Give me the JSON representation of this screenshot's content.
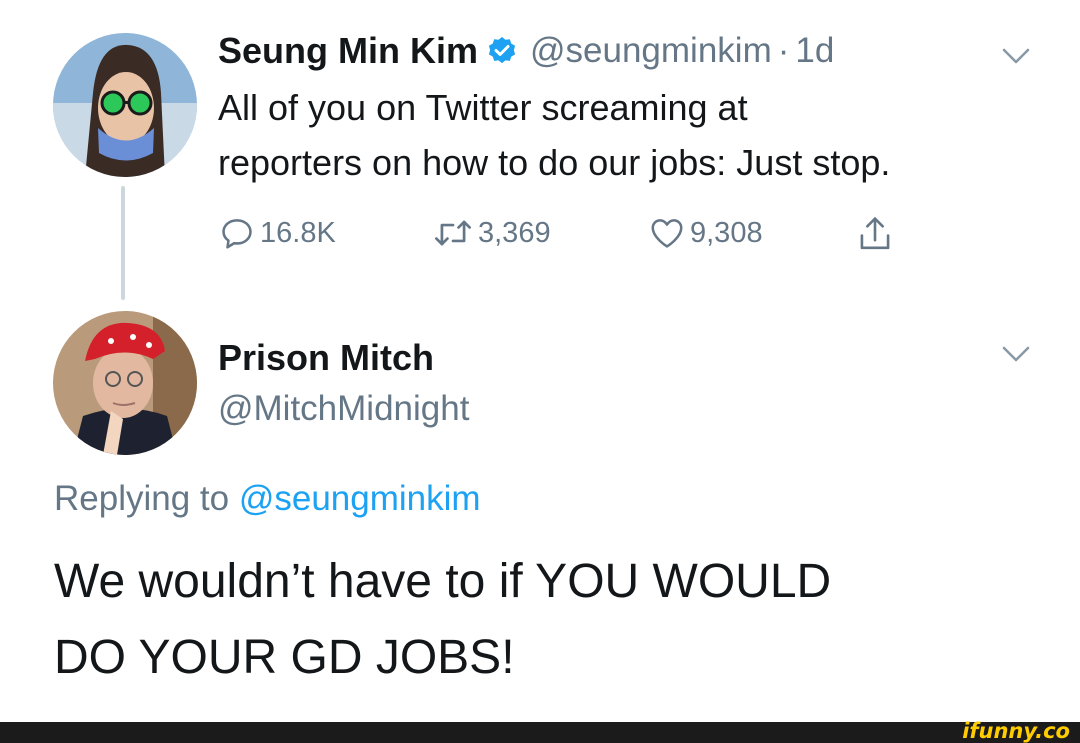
{
  "tweet": {
    "author_name": "Seung Min Kim",
    "handle": "@seungminkim",
    "separator": "·",
    "time": "1d",
    "text_line1": "All of you on Twitter screaming at",
    "text_line2": "reporters on how to do our jobs: Just stop.",
    "replies": "16.8K",
    "retweets": "3,369",
    "likes": "9,308"
  },
  "reply": {
    "author_name": "Prison Mitch",
    "handle": "@MitchMidnight",
    "replying_prefix": "Replying to",
    "replying_handle": "@seungminkim",
    "text_line1": "We wouldn’t have to if YOU WOULD",
    "text_line2": "DO YOUR GD JOBS!"
  },
  "footer": {
    "watermark": "ifunny.co"
  },
  "colors": {
    "verified": "#1da1f2",
    "muted": "#657786",
    "footer_bg": "#1b1b1b",
    "watermark": "#ffcc00"
  },
  "icons": [
    "verified-badge-icon",
    "chevron-down-icon",
    "reply-icon",
    "retweet-icon",
    "like-icon",
    "share-icon"
  ]
}
